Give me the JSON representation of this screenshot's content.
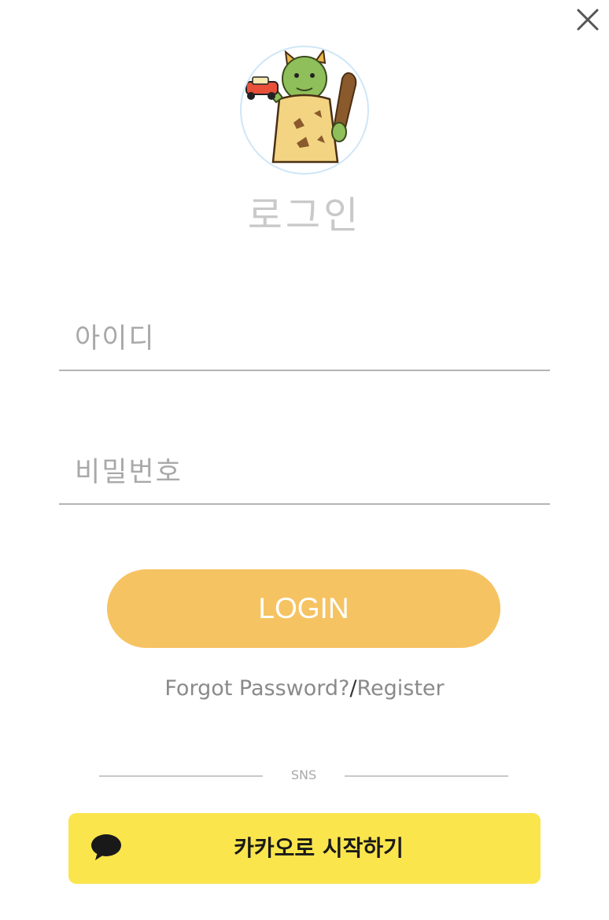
{
  "dialog": {
    "close_icon": "close-icon",
    "avatar_icon": "ogre-mascot-icon",
    "title": "로그인"
  },
  "form": {
    "id_placeholder": "아이디",
    "password_placeholder": "비밀번호",
    "login_label": "LOGIN"
  },
  "links": {
    "forgot_label": "Forgot Password?",
    "separator": "/",
    "register_label": "Register"
  },
  "sns": {
    "divider_label": "SNS",
    "kakao_label": "카카오로 시작하기",
    "kakao_icon": "speech-bubble-icon"
  },
  "colors": {
    "login_button": "#f6c362",
    "kakao_button": "#fae54d",
    "title_text": "#c9c9c9"
  }
}
